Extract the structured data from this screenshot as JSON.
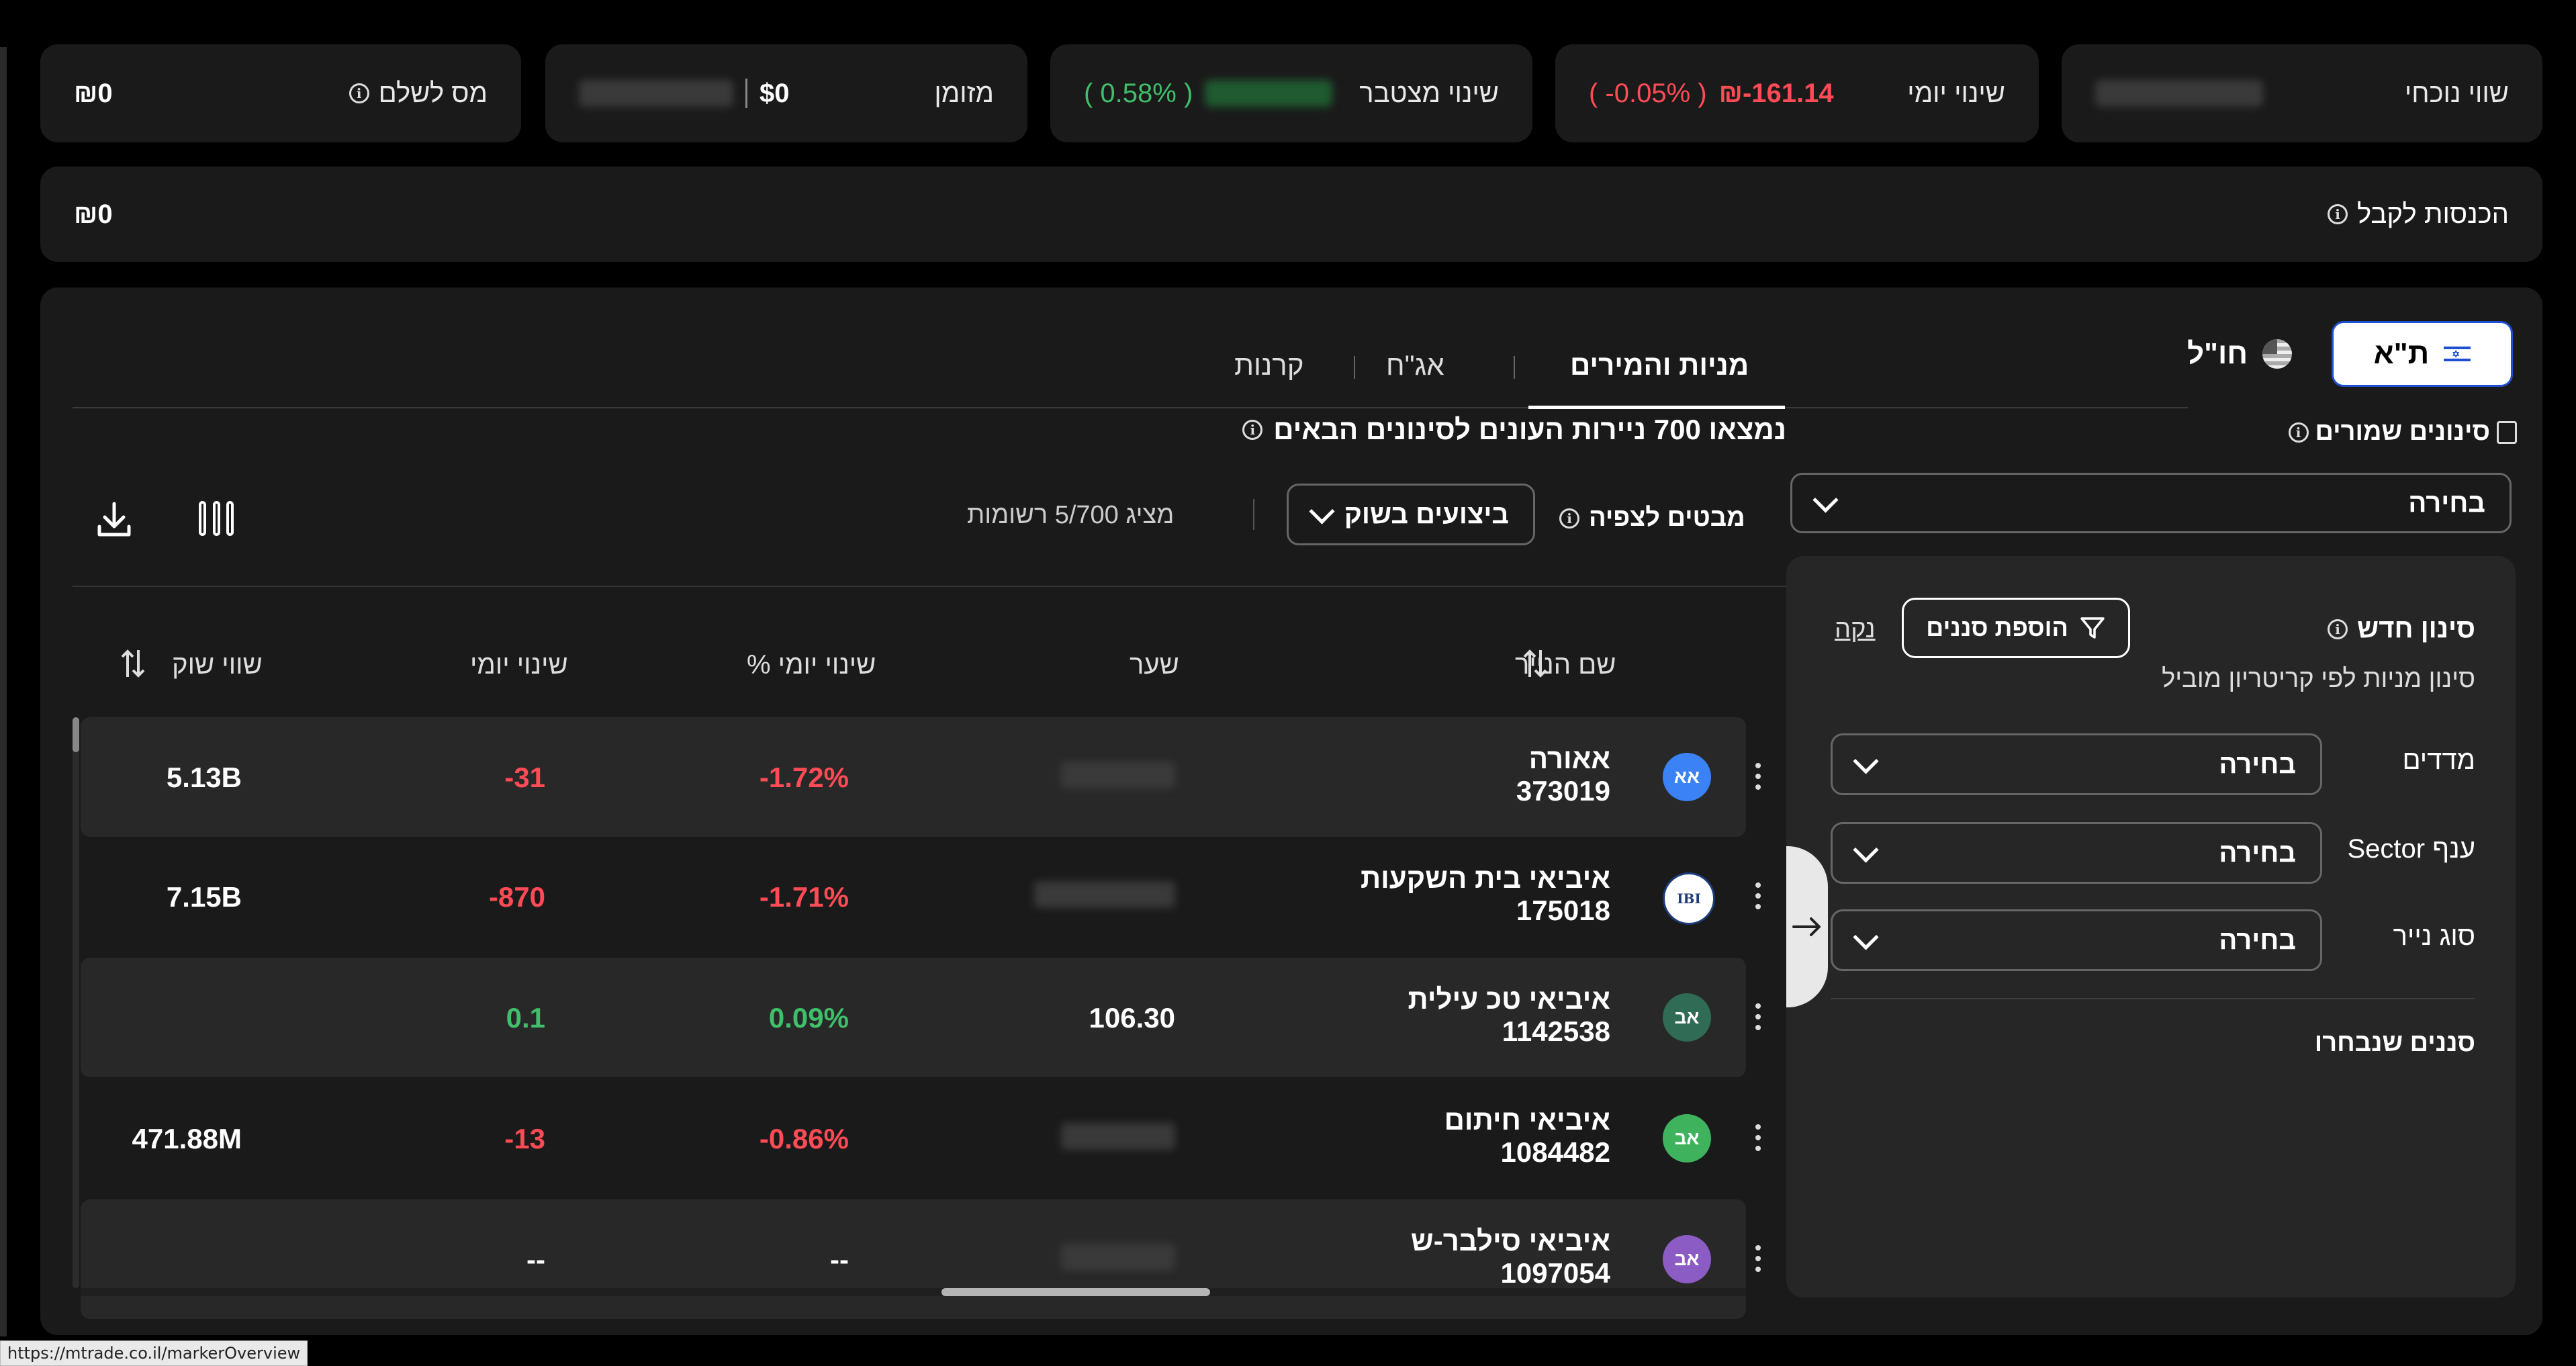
{
  "stats": {
    "current_value_label": "שווי נוכחי",
    "daily_change_label": "שינוי יומי",
    "daily_change_value": "₪-161.14",
    "daily_change_pct": "( -0.05% )",
    "cumulative_change_label": "שינוי מצטבר",
    "cumulative_change_pct": "( 0.58% )",
    "cash_label": "מזומן",
    "cash_value": "$0",
    "tax_label": "מס לשלם",
    "tax_value": "₪0"
  },
  "income": {
    "label": "הכנסות לקבל",
    "value": "₪0"
  },
  "market": {
    "tase_label": "ת\"א",
    "abroad_label": "חו\"ל"
  },
  "tabs": [
    {
      "label": "מניות והמירים",
      "active": true
    },
    {
      "label": "אג\"ח",
      "active": false
    },
    {
      "label": "קרנות",
      "active": false
    }
  ],
  "results": {
    "title": "נמצאו 700 ניירות העונים לסינונים הבאים",
    "views_label": "מבטים לצפיה",
    "view_select": "ביצועים בשוק",
    "showing": "מציג 5/700 רשומות"
  },
  "saved_filters": {
    "label": "סינונים שמורים",
    "select": "בחירה"
  },
  "new_filter": {
    "title": "סינון חדש",
    "subtitle": "סינון מניות לפי קריטריון מוביל",
    "add_button": "הוספת סננים",
    "clear": "נקה",
    "fields": [
      {
        "label": "מדדים",
        "value": "בחירה"
      },
      {
        "label": "ענף Sector",
        "value": "בחירה"
      },
      {
        "label": "סוג נייר",
        "value": "בחירה"
      }
    ],
    "selected_label": "סננים שנבחרו"
  },
  "table": {
    "headers": {
      "name": "שם הנייר",
      "price": "שער",
      "daily_pct": "שינוי יומי %",
      "daily": "שינוי יומי",
      "market_cap": "שווי שוק"
    },
    "rows": [
      {
        "name": "אאורה",
        "id": "373019",
        "avatar": "אא",
        "avatar_color": "#3b82f6",
        "price": "",
        "pct": "-1.72%",
        "change": "-31",
        "cap": "5.13B",
        "trend": "down"
      },
      {
        "name": "איביאי בית השקעות",
        "id": "175018",
        "avatar": "IBI",
        "avatar_color": "#ffffff",
        "price": "",
        "pct": "-1.71%",
        "change": "-870",
        "cap": "7.15B",
        "trend": "down"
      },
      {
        "name": "איביאי טכ עילית",
        "id": "1142538",
        "avatar": "אב",
        "avatar_color": "#2f6b55",
        "price": "106.30",
        "pct": "0.09%",
        "change": "0.1",
        "cap": "",
        "trend": "up"
      },
      {
        "name": "איביאי חיתום",
        "id": "1084482",
        "avatar": "אב",
        "avatar_color": "#3fb25e",
        "price": "",
        "pct": "-0.86%",
        "change": "-13",
        "cap": "471.88M",
        "trend": "down"
      },
      {
        "name": "איביאי סילבר-ש",
        "id": "1097054",
        "avatar": "אב",
        "avatar_color": "#8b5cc4",
        "price": "",
        "pct": "--",
        "change": "--",
        "cap": "",
        "trend": "none"
      }
    ]
  },
  "status_url": "https://mtrade.co.il/markerOverview"
}
